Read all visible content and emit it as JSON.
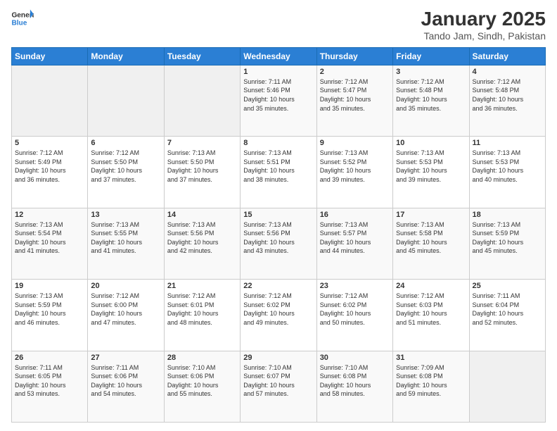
{
  "logo": {
    "line1": "General",
    "line2": "Blue"
  },
  "title": "January 2025",
  "subtitle": "Tando Jam, Sindh, Pakistan",
  "header_days": [
    "Sunday",
    "Monday",
    "Tuesday",
    "Wednesday",
    "Thursday",
    "Friday",
    "Saturday"
  ],
  "weeks": [
    [
      {
        "day": "",
        "info": ""
      },
      {
        "day": "",
        "info": ""
      },
      {
        "day": "",
        "info": ""
      },
      {
        "day": "1",
        "info": "Sunrise: 7:11 AM\nSunset: 5:46 PM\nDaylight: 10 hours\nand 35 minutes."
      },
      {
        "day": "2",
        "info": "Sunrise: 7:12 AM\nSunset: 5:47 PM\nDaylight: 10 hours\nand 35 minutes."
      },
      {
        "day": "3",
        "info": "Sunrise: 7:12 AM\nSunset: 5:48 PM\nDaylight: 10 hours\nand 35 minutes."
      },
      {
        "day": "4",
        "info": "Sunrise: 7:12 AM\nSunset: 5:48 PM\nDaylight: 10 hours\nand 36 minutes."
      }
    ],
    [
      {
        "day": "5",
        "info": "Sunrise: 7:12 AM\nSunset: 5:49 PM\nDaylight: 10 hours\nand 36 minutes."
      },
      {
        "day": "6",
        "info": "Sunrise: 7:12 AM\nSunset: 5:50 PM\nDaylight: 10 hours\nand 37 minutes."
      },
      {
        "day": "7",
        "info": "Sunrise: 7:13 AM\nSunset: 5:50 PM\nDaylight: 10 hours\nand 37 minutes."
      },
      {
        "day": "8",
        "info": "Sunrise: 7:13 AM\nSunset: 5:51 PM\nDaylight: 10 hours\nand 38 minutes."
      },
      {
        "day": "9",
        "info": "Sunrise: 7:13 AM\nSunset: 5:52 PM\nDaylight: 10 hours\nand 39 minutes."
      },
      {
        "day": "10",
        "info": "Sunrise: 7:13 AM\nSunset: 5:53 PM\nDaylight: 10 hours\nand 39 minutes."
      },
      {
        "day": "11",
        "info": "Sunrise: 7:13 AM\nSunset: 5:53 PM\nDaylight: 10 hours\nand 40 minutes."
      }
    ],
    [
      {
        "day": "12",
        "info": "Sunrise: 7:13 AM\nSunset: 5:54 PM\nDaylight: 10 hours\nand 41 minutes."
      },
      {
        "day": "13",
        "info": "Sunrise: 7:13 AM\nSunset: 5:55 PM\nDaylight: 10 hours\nand 41 minutes."
      },
      {
        "day": "14",
        "info": "Sunrise: 7:13 AM\nSunset: 5:56 PM\nDaylight: 10 hours\nand 42 minutes."
      },
      {
        "day": "15",
        "info": "Sunrise: 7:13 AM\nSunset: 5:56 PM\nDaylight: 10 hours\nand 43 minutes."
      },
      {
        "day": "16",
        "info": "Sunrise: 7:13 AM\nSunset: 5:57 PM\nDaylight: 10 hours\nand 44 minutes."
      },
      {
        "day": "17",
        "info": "Sunrise: 7:13 AM\nSunset: 5:58 PM\nDaylight: 10 hours\nand 45 minutes."
      },
      {
        "day": "18",
        "info": "Sunrise: 7:13 AM\nSunset: 5:59 PM\nDaylight: 10 hours\nand 45 minutes."
      }
    ],
    [
      {
        "day": "19",
        "info": "Sunrise: 7:13 AM\nSunset: 5:59 PM\nDaylight: 10 hours\nand 46 minutes."
      },
      {
        "day": "20",
        "info": "Sunrise: 7:12 AM\nSunset: 6:00 PM\nDaylight: 10 hours\nand 47 minutes."
      },
      {
        "day": "21",
        "info": "Sunrise: 7:12 AM\nSunset: 6:01 PM\nDaylight: 10 hours\nand 48 minutes."
      },
      {
        "day": "22",
        "info": "Sunrise: 7:12 AM\nSunset: 6:02 PM\nDaylight: 10 hours\nand 49 minutes."
      },
      {
        "day": "23",
        "info": "Sunrise: 7:12 AM\nSunset: 6:02 PM\nDaylight: 10 hours\nand 50 minutes."
      },
      {
        "day": "24",
        "info": "Sunrise: 7:12 AM\nSunset: 6:03 PM\nDaylight: 10 hours\nand 51 minutes."
      },
      {
        "day": "25",
        "info": "Sunrise: 7:11 AM\nSunset: 6:04 PM\nDaylight: 10 hours\nand 52 minutes."
      }
    ],
    [
      {
        "day": "26",
        "info": "Sunrise: 7:11 AM\nSunset: 6:05 PM\nDaylight: 10 hours\nand 53 minutes."
      },
      {
        "day": "27",
        "info": "Sunrise: 7:11 AM\nSunset: 6:06 PM\nDaylight: 10 hours\nand 54 minutes."
      },
      {
        "day": "28",
        "info": "Sunrise: 7:10 AM\nSunset: 6:06 PM\nDaylight: 10 hours\nand 55 minutes."
      },
      {
        "day": "29",
        "info": "Sunrise: 7:10 AM\nSunset: 6:07 PM\nDaylight: 10 hours\nand 57 minutes."
      },
      {
        "day": "30",
        "info": "Sunrise: 7:10 AM\nSunset: 6:08 PM\nDaylight: 10 hours\nand 58 minutes."
      },
      {
        "day": "31",
        "info": "Sunrise: 7:09 AM\nSunset: 6:08 PM\nDaylight: 10 hours\nand 59 minutes."
      },
      {
        "day": "",
        "info": ""
      }
    ]
  ]
}
